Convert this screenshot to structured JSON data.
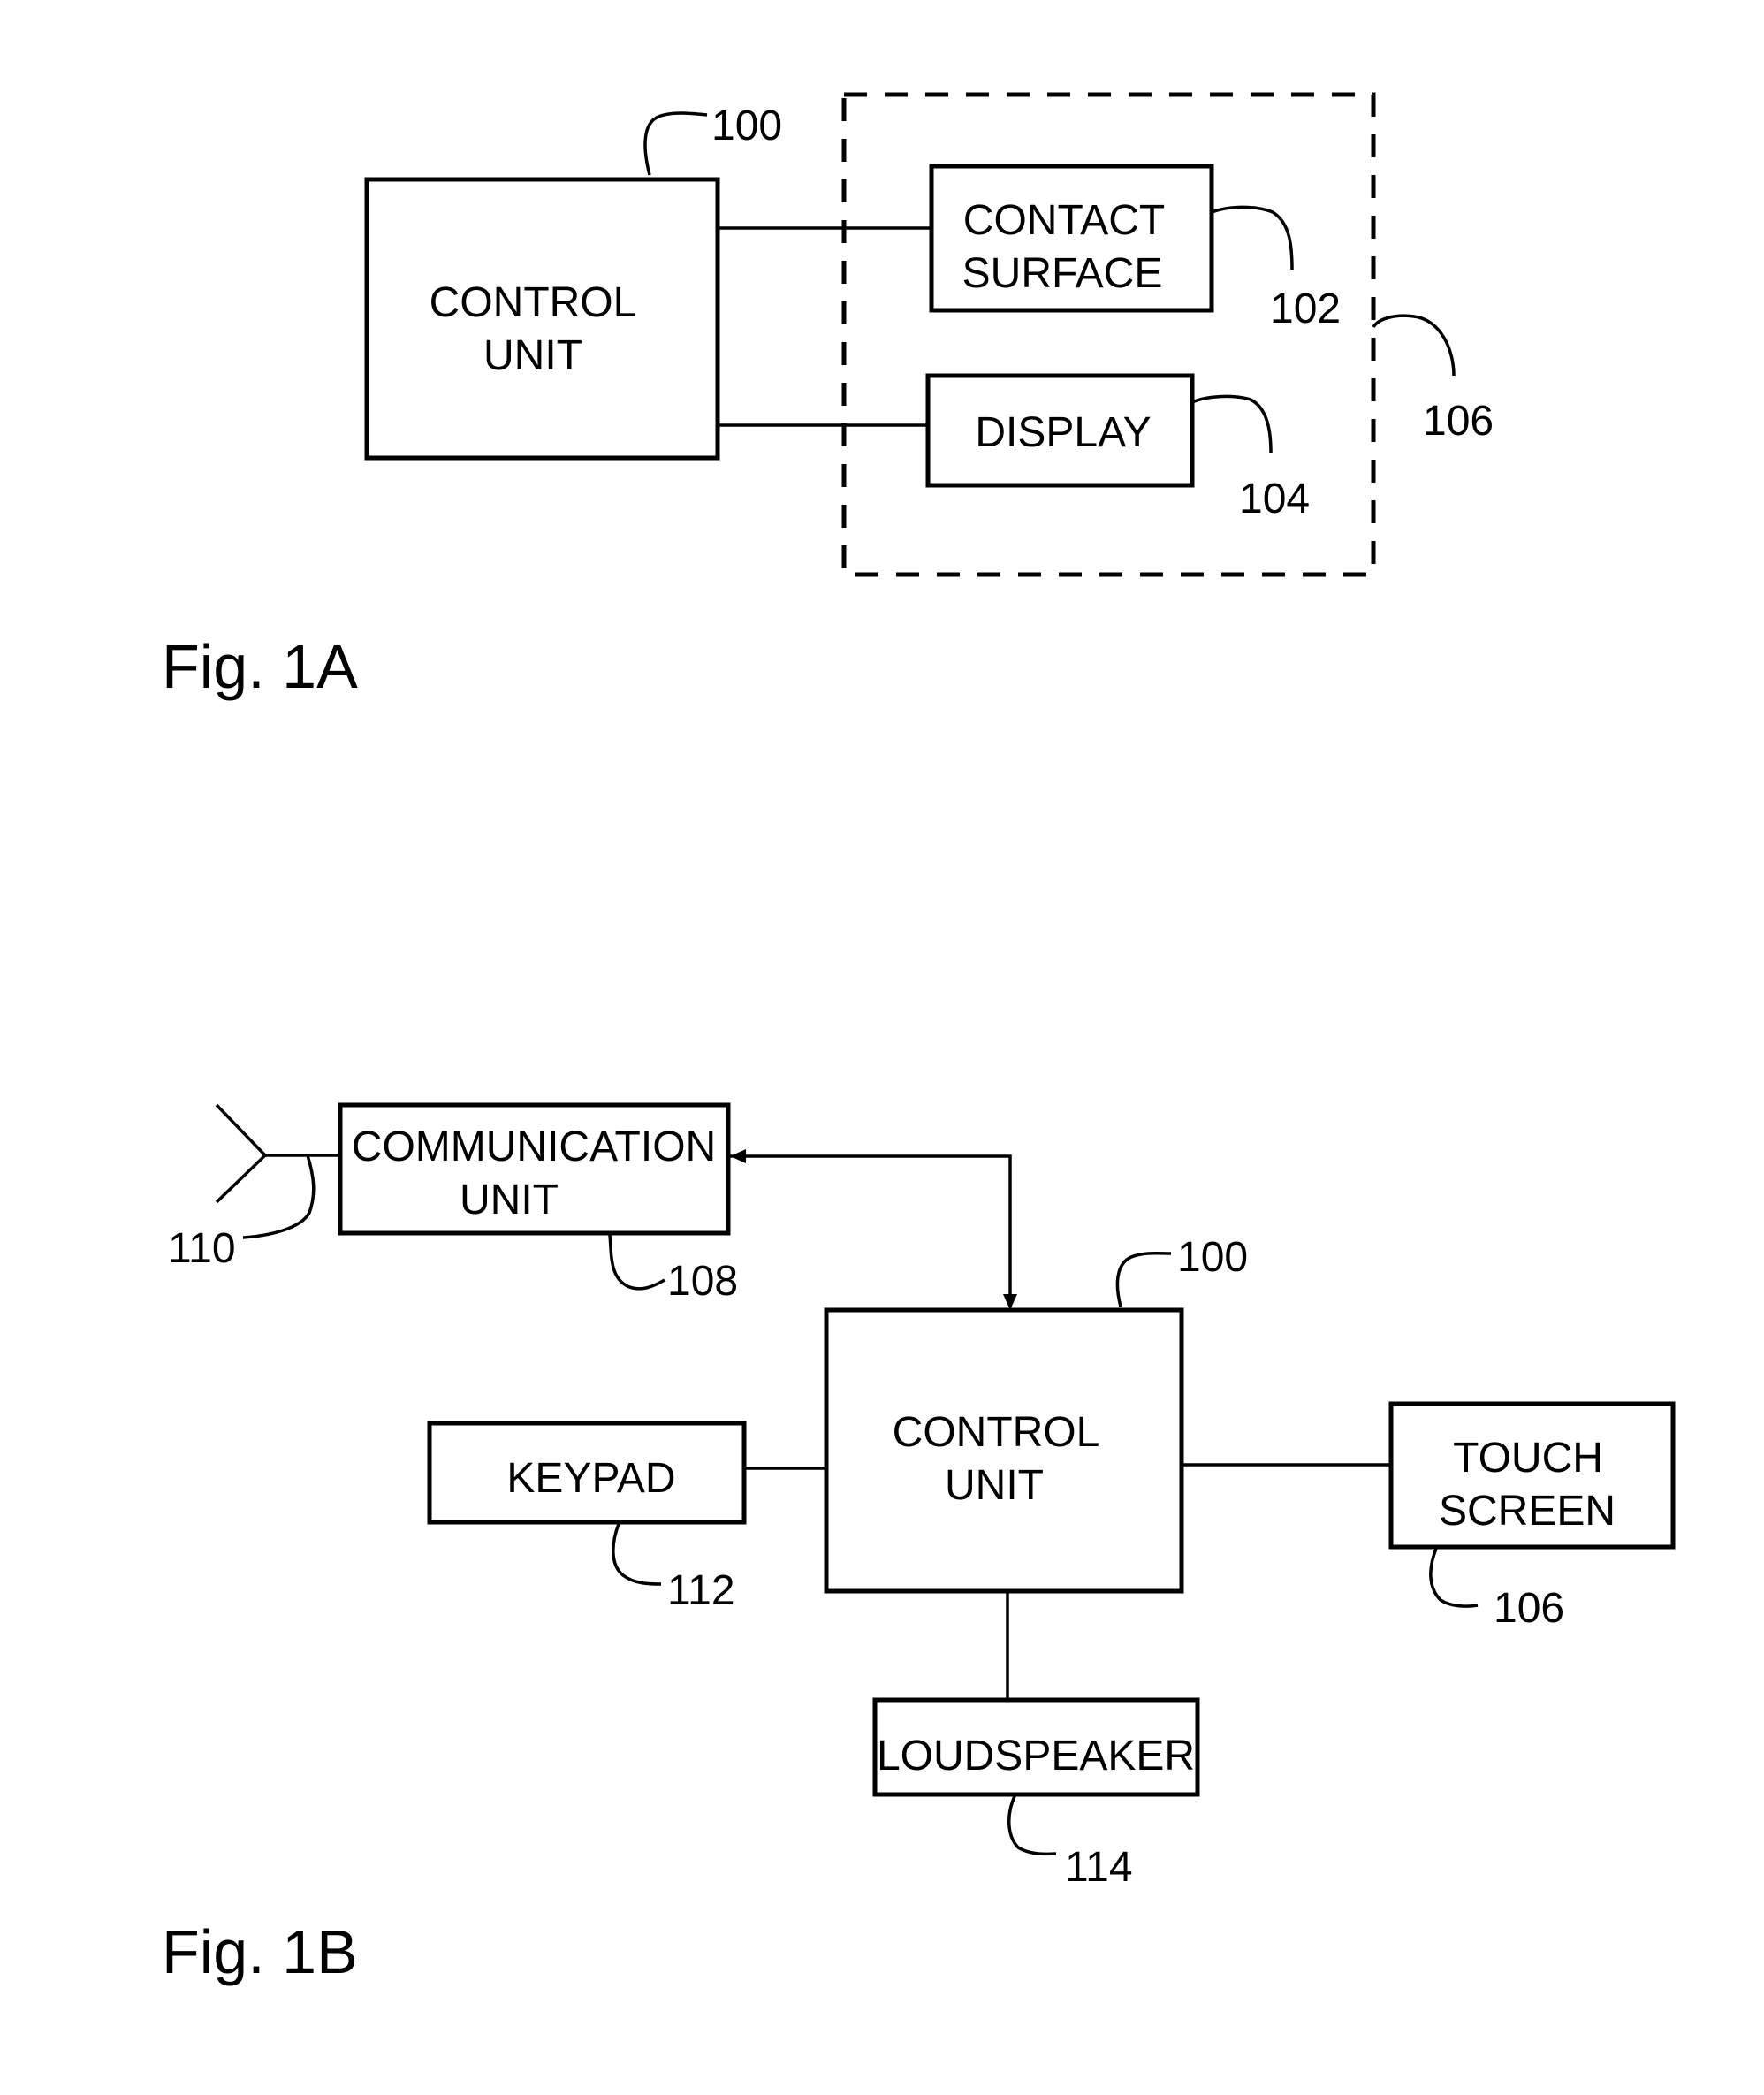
{
  "fig_1a": {
    "caption": "Fig. 1A",
    "control_unit": {
      "line1": "CONTROL",
      "line2": "UNIT",
      "ref": "100"
    },
    "contact_surface": {
      "line1": "CONTACT",
      "line2": "SURFACE",
      "ref": "102"
    },
    "display": {
      "label": "DISPLAY",
      "ref": "104"
    },
    "touch_screen_group": {
      "ref": "106"
    }
  },
  "fig_1b": {
    "caption": "Fig. 1B",
    "communication_unit": {
      "line1": "COMMUNICATION",
      "line2": "UNIT",
      "ref": "108"
    },
    "antenna": {
      "ref": "110"
    },
    "control_unit": {
      "line1": "CONTROL",
      "line2": "UNIT",
      "ref": "100"
    },
    "keypad": {
      "label": "KEYPAD",
      "ref": "112"
    },
    "touch_screen": {
      "line1": "TOUCH",
      "line2": "SCREEN",
      "ref": "106"
    },
    "loudspeaker": {
      "label": "LOUDSPEAKER",
      "ref": "114"
    }
  }
}
